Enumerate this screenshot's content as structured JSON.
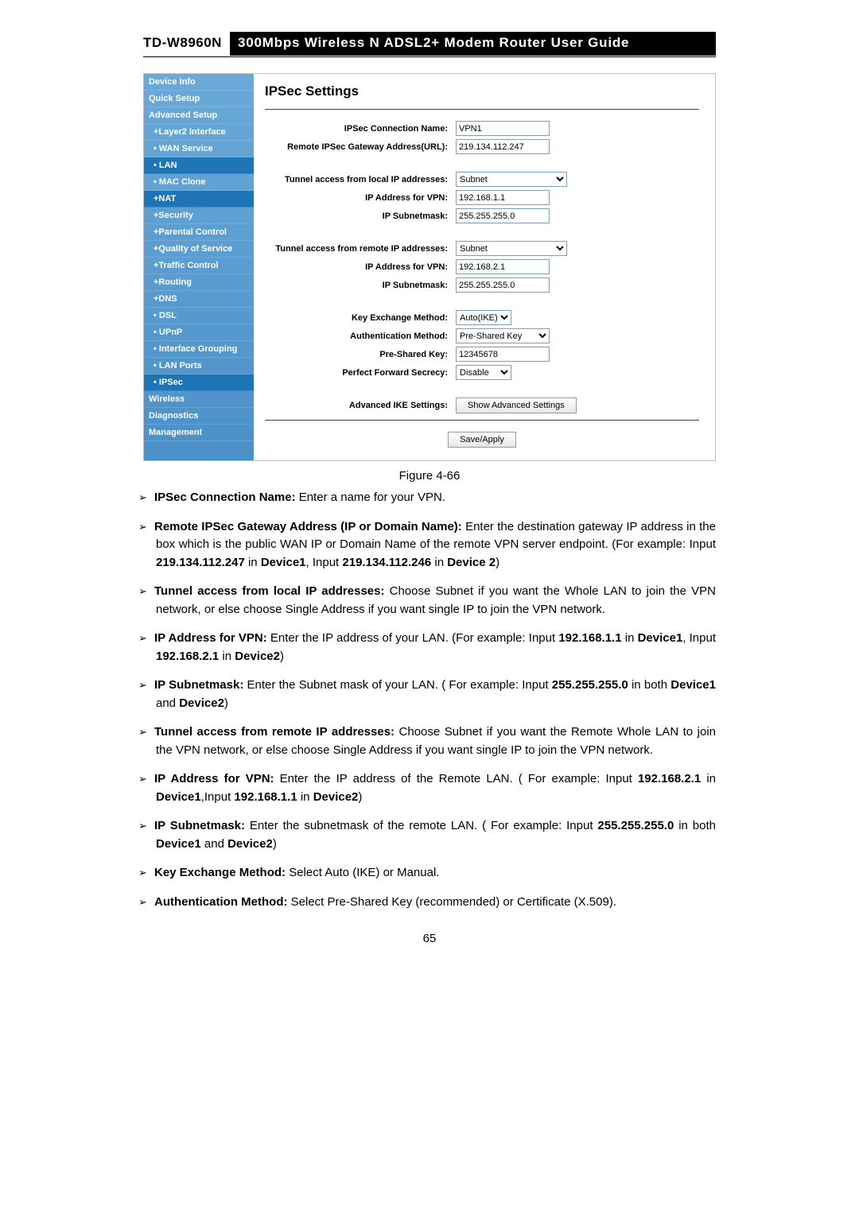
{
  "header": {
    "model": "TD-W8960N",
    "title": "300Mbps Wireless N ADSL2+ Modem Router User Guide"
  },
  "sidebar": {
    "items": [
      {
        "label": "Device Info",
        "cls": ""
      },
      {
        "label": "Quick Setup",
        "cls": ""
      },
      {
        "label": "Advanced Setup",
        "cls": ""
      },
      {
        "label": "+Layer2 Interface",
        "cls": "sub"
      },
      {
        "label": "• WAN Service",
        "cls": "sub"
      },
      {
        "label": "• LAN",
        "cls": "sub active"
      },
      {
        "label": "• MAC Clone",
        "cls": "sub"
      },
      {
        "label": "+NAT",
        "cls": "sub active"
      },
      {
        "label": "+Security",
        "cls": "sub"
      },
      {
        "label": "+Parental Control",
        "cls": "sub"
      },
      {
        "label": "+Quality of Service",
        "cls": "sub"
      },
      {
        "label": "+Traffic Control",
        "cls": "sub"
      },
      {
        "label": "+Routing",
        "cls": "sub"
      },
      {
        "label": "+DNS",
        "cls": "sub"
      },
      {
        "label": "• DSL",
        "cls": "sub"
      },
      {
        "label": "• UPnP",
        "cls": "sub"
      },
      {
        "label": "• Interface Grouping",
        "cls": "sub"
      },
      {
        "label": "• LAN Ports",
        "cls": "sub"
      },
      {
        "label": "• IPSec",
        "cls": "sub active"
      },
      {
        "label": "Wireless",
        "cls": ""
      },
      {
        "label": "Diagnostics",
        "cls": ""
      },
      {
        "label": "Management",
        "cls": ""
      }
    ]
  },
  "panel": {
    "heading": "IPSec Settings",
    "rows": [
      {
        "label": "IPSec Connection Name:",
        "type": "text",
        "value": "VPN1"
      },
      {
        "label": "Remote IPSec Gateway Address(URL):",
        "type": "text",
        "value": "219.134.112.247"
      },
      {
        "gap": true
      },
      {
        "label": "Tunnel access from local IP addresses:",
        "type": "select",
        "cls": "w1",
        "value": "Subnet"
      },
      {
        "label": "IP Address for VPN:",
        "type": "text",
        "value": "192.168.1.1"
      },
      {
        "label": "IP Subnetmask:",
        "type": "text",
        "value": "255.255.255.0"
      },
      {
        "gap": true
      },
      {
        "label": "Tunnel access from remote IP addresses:",
        "type": "select",
        "cls": "w1",
        "value": "Subnet"
      },
      {
        "label": "IP Address for VPN:",
        "type": "text",
        "value": "192.168.2.1"
      },
      {
        "label": "IP Subnetmask:",
        "type": "text",
        "value": "255.255.255.0"
      },
      {
        "gap": true
      },
      {
        "label": "Key Exchange Method:",
        "type": "select",
        "cls": "w2",
        "value": "Auto(IKE)"
      },
      {
        "label": "Authentication Method:",
        "type": "select",
        "cls": "w3",
        "value": "Pre-Shared Key"
      },
      {
        "label": "Pre-Shared Key:",
        "type": "text",
        "value": "12345678"
      },
      {
        "label": "Perfect Forward Secrecy:",
        "type": "select",
        "cls": "w2",
        "value": "Disable"
      },
      {
        "gap": true
      },
      {
        "label": "Advanced IKE Settings:",
        "type": "button",
        "value": "Show Advanced Settings"
      }
    ],
    "save": "Save/Apply"
  },
  "figure": "Figure 4-66",
  "notes": [
    "<b>IPSec Connection Name:</b> Enter a name for your VPN.",
    "<b>Remote IPSec Gateway Address (IP or Domain Name):</b> Enter the destination gateway IP address in the box which is the public WAN IP or Domain Name of the remote VPN server endpoint. (For example: Input <b>219.134.112.247</b> in <b>Device1</b>, Input <b>219.134.112.246</b> in <b>Device 2</b>)",
    "<b>Tunnel access from local IP addresses:</b> Choose Subnet if you want the Whole LAN to join the VPN network, or else choose Single Address if you want single IP to join the VPN network.",
    "<b>IP Address for VPN:</b> Enter the IP address of your LAN. (For example: Input <b>192.168.1.1</b> in <b>Device1</b>, Input <b>192.168.2.1</b> in <b>Device2</b>)",
    "<b>IP Subnetmask:</b> Enter the Subnet mask of your LAN. ( For example: Input <b>255.255.255.0</b> in both <b>Device1</b> and <b>Device2</b>)",
    "<b>Tunnel access from remote IP addresses:</b> Choose Subnet if you want the Remote Whole LAN to join the VPN network, or else choose Single Address if you want single IP to join the VPN network.",
    "<b>IP Address for VPN:</b> Enter the IP address of the Remote LAN. ( For example: Input <b>192.168.2.1</b> in <b>Device1</b>,Input <b>192.168.1.1</b> in <b>Device2</b>)",
    "<b>IP Subnetmask:</b> Enter the subnetmask of the remote LAN. ( For example: Input <b>255.255.255.0</b> in both <b>Device1</b> and <b>Device2</b>)",
    "<b>Key Exchange Method:</b> Select Auto (IKE) or Manual.",
    "<b>Authentication Method:</b> Select Pre-Shared Key (recommended) or Certificate (X.509)."
  ],
  "pagenum": "65"
}
